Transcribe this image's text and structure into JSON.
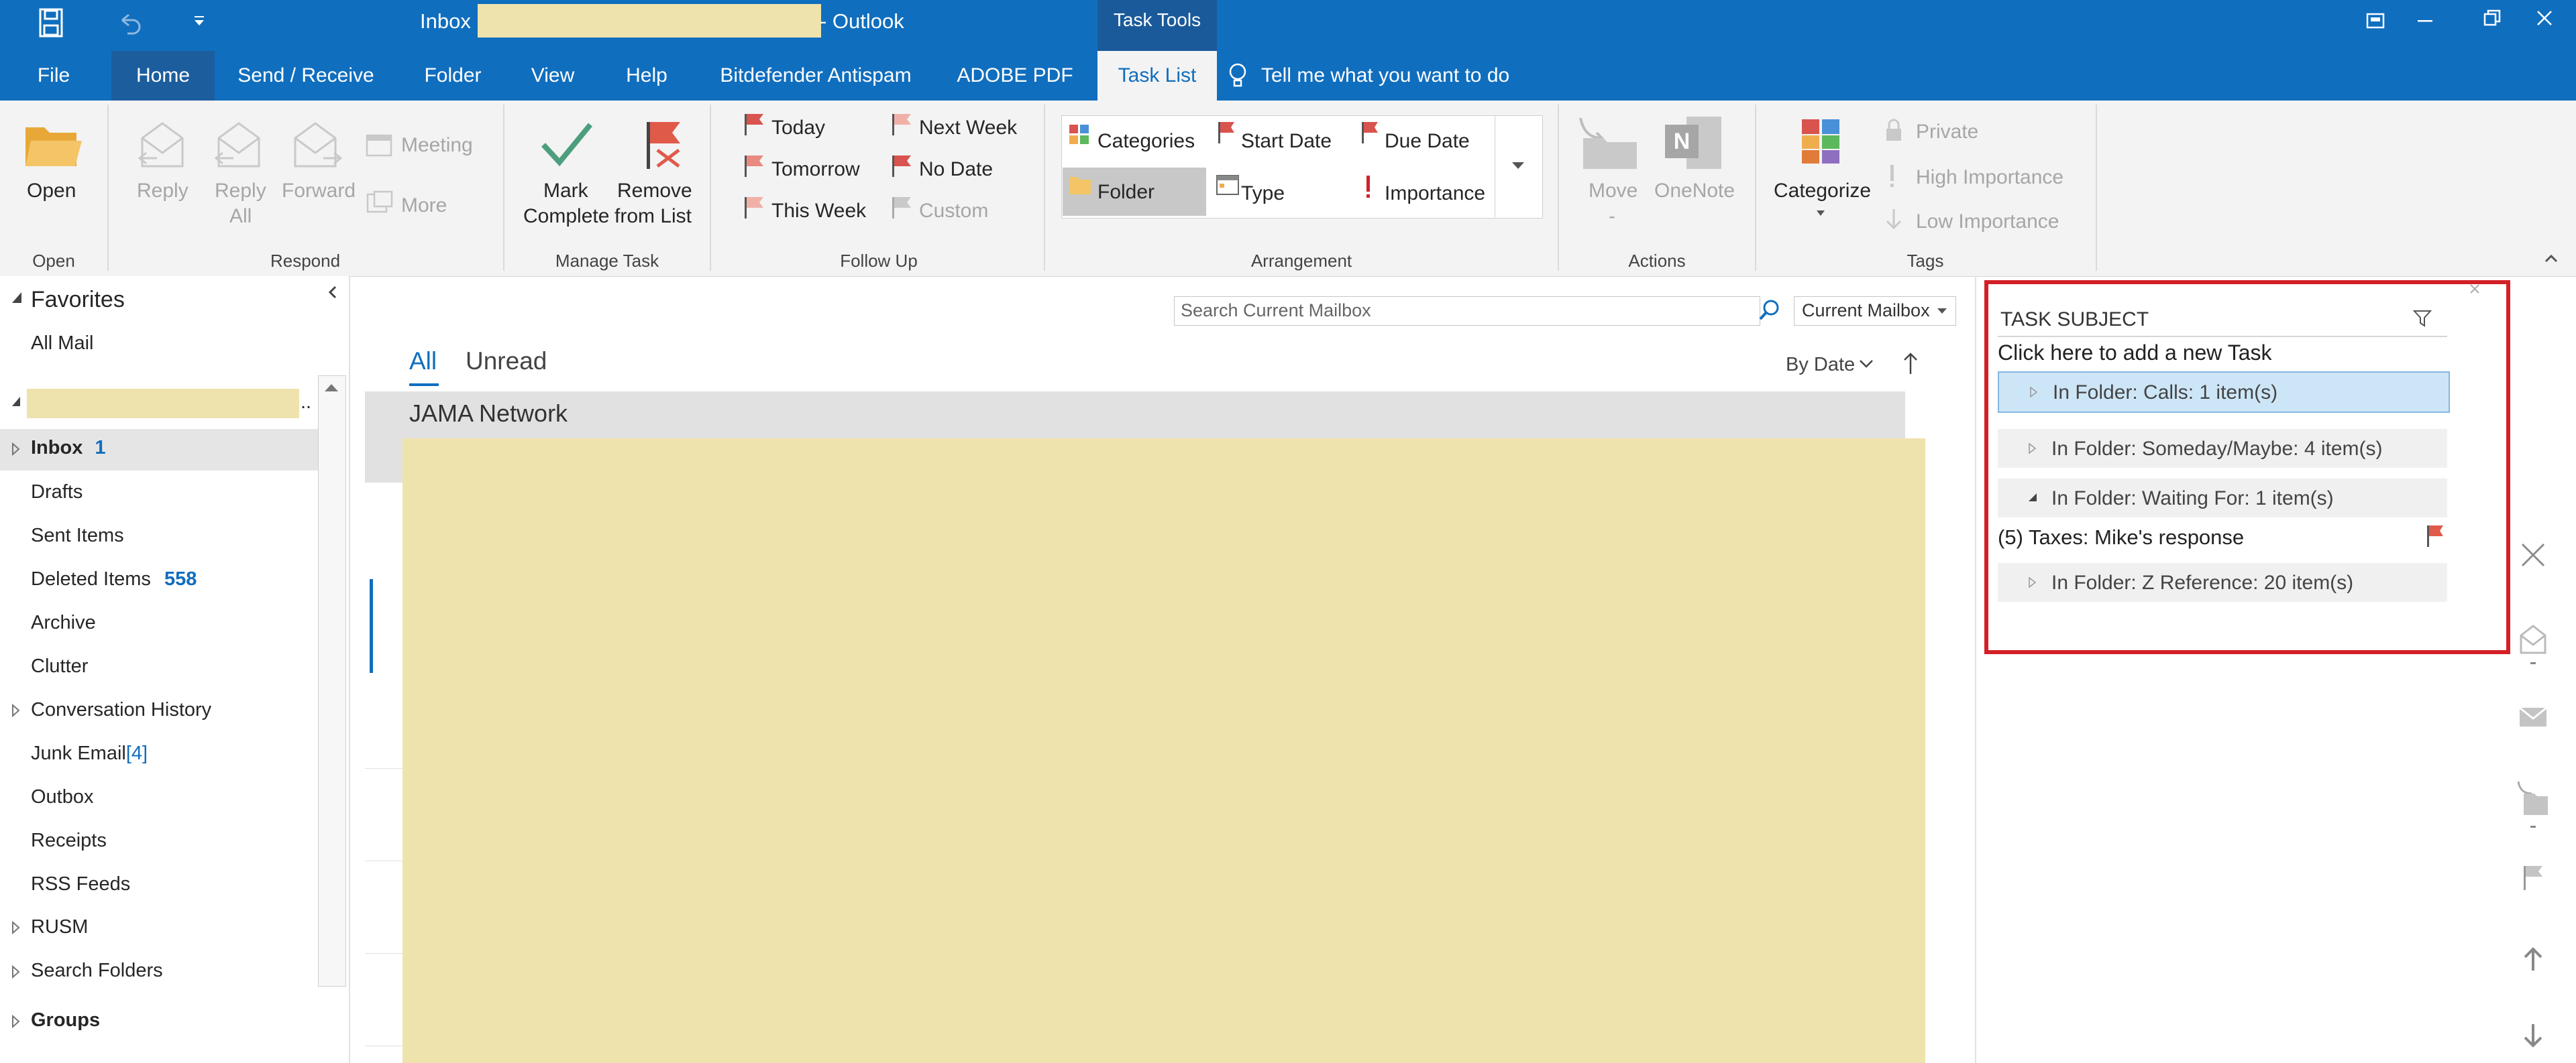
{
  "titlebar": {
    "folder": "Inbox",
    "app": "- Outlook",
    "tools_label": "Task Tools"
  },
  "tabs": {
    "file": "File",
    "home": "Home",
    "send_receive": "Send / Receive",
    "folder": "Folder",
    "view": "View",
    "help": "Help",
    "bitdefender": "Bitdefender Antispam",
    "adobe": "ADOBE PDF",
    "task_list": "Task List",
    "tell_me": "Tell me what you want to do"
  },
  "ribbon": {
    "open": "Open",
    "reply": "Reply",
    "reply_all_1": "Reply",
    "reply_all_2": "All",
    "forward": "Forward",
    "meeting": "Meeting",
    "more": "More",
    "mark_complete_1": "Mark",
    "mark_complete_2": "Complete",
    "remove_1": "Remove",
    "remove_2": "from List",
    "today": "Today",
    "tomorrow": "Tomorrow",
    "this_week": "This Week",
    "next_week": "Next Week",
    "no_date": "No Date",
    "custom": "Custom",
    "categories": "Categories",
    "start_date": "Start Date",
    "due_date": "Due Date",
    "folder": "Folder",
    "type": "Type",
    "importance": "Importance",
    "move": "Move",
    "onenote": "OneNote",
    "categorize": "Categorize",
    "private": "Private",
    "high_importance": "High Importance",
    "low_importance": "Low Importance",
    "groups": {
      "open": "Open",
      "respond": "Respond",
      "manage_task": "Manage Task",
      "follow_up": "Follow Up",
      "arrangement": "Arrangement",
      "actions": "Actions",
      "tags": "Tags"
    }
  },
  "leftpane": {
    "favorites": "Favorites",
    "all_mail": "All Mail",
    "folders": {
      "inbox": "Inbox",
      "inbox_count": "1",
      "drafts": "Drafts",
      "sent": "Sent Items",
      "deleted": "Deleted Items",
      "deleted_count": "558",
      "archive": "Archive",
      "clutter": "Clutter",
      "conversation_history": "Conversation History",
      "junk": "Junk Email",
      "junk_count": "[4]",
      "outbox": "Outbox",
      "receipts": "Receipts",
      "rss": "RSS Feeds",
      "rusm": "RUSM",
      "search_folders": "Search Folders",
      "groups": "Groups"
    }
  },
  "maillist": {
    "search_placeholder": "Search Current Mailbox",
    "scope": "Current Mailbox",
    "filter_all": "All",
    "filter_unread": "Unread",
    "sort": "By Date",
    "group_header": "JAMA Network"
  },
  "todo": {
    "column_header": "TASK SUBJECT",
    "add_new": "Click here to add a new Task",
    "rows": [
      "In Folder: Calls: 1 item(s)",
      "In Folder: Someday/Maybe: 4 item(s)",
      "In Folder: Waiting For: 1 item(s)",
      "In Folder: Z Reference: 20 item(s)"
    ],
    "task": "(5) Taxes: Mike's response"
  },
  "colors": {
    "brand_blue": "#106ebe",
    "highlight_red": "#d32027",
    "flag_red": "#e05a4a",
    "redaction": "#efe3ad"
  }
}
